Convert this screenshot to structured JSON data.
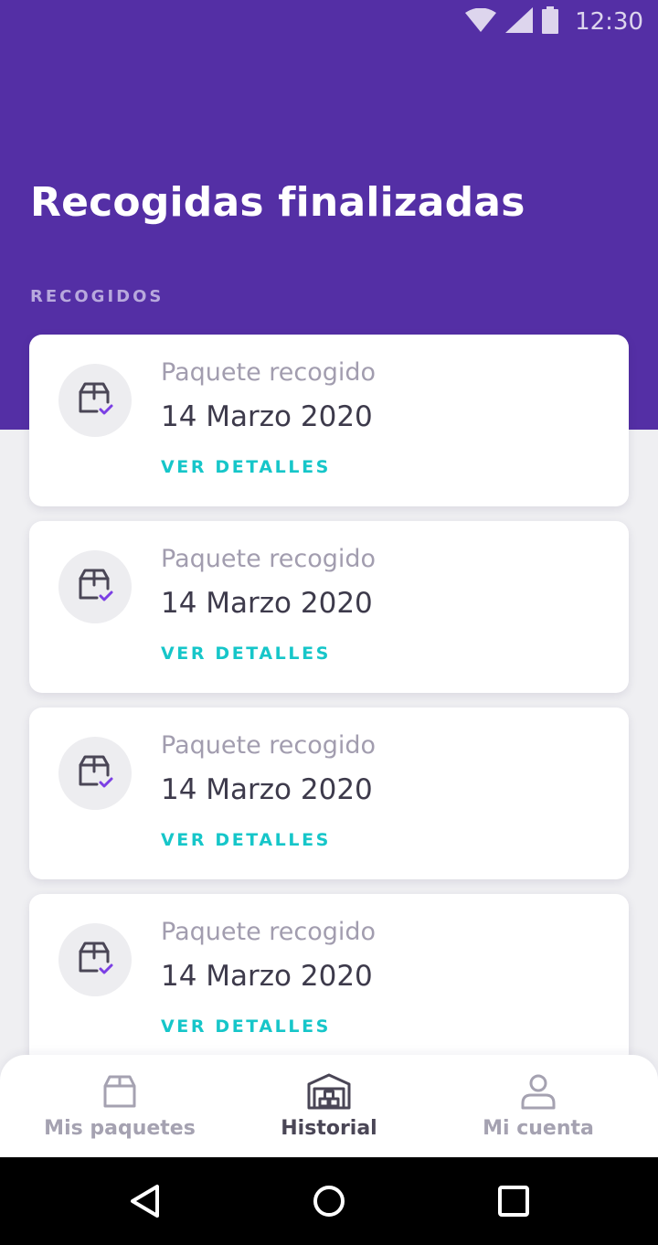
{
  "status_bar": {
    "time": "12:30",
    "icons": [
      "wifi-icon",
      "cell-signal-icon",
      "battery-icon"
    ]
  },
  "header": {
    "title": "Recogidas finalizadas",
    "section_label": "RECOGIDOS"
  },
  "cards": [
    {
      "label": "Paquete recogido",
      "date": "14 Marzo 2020",
      "action": "VER DETALLES",
      "icon": "package-check-icon"
    },
    {
      "label": "Paquete recogido",
      "date": "14 Marzo 2020",
      "action": "VER DETALLES",
      "icon": "package-check-icon"
    },
    {
      "label": "Paquete recogido",
      "date": "14 Marzo 2020",
      "action": "VER DETALLES",
      "icon": "package-check-icon"
    },
    {
      "label": "Paquete recogido",
      "date": "14 Marzo 2020",
      "action": "VER DETALLES",
      "icon": "package-check-icon"
    }
  ],
  "bottom_nav": {
    "items": [
      {
        "label": "Mis paquetes",
        "icon": "package-icon",
        "active": false
      },
      {
        "label": "Historial",
        "icon": "warehouse-icon",
        "active": true
      },
      {
        "label": "Mi cuenta",
        "icon": "user-icon",
        "active": false
      }
    ]
  },
  "system_nav": {
    "icons": [
      "back-icon",
      "home-icon",
      "recents-icon"
    ]
  },
  "colors": {
    "header_bg": "#542fa5",
    "accent_teal": "#16c6c9",
    "check_purple": "#7b3fe4",
    "page_bg": "#efeff2"
  }
}
